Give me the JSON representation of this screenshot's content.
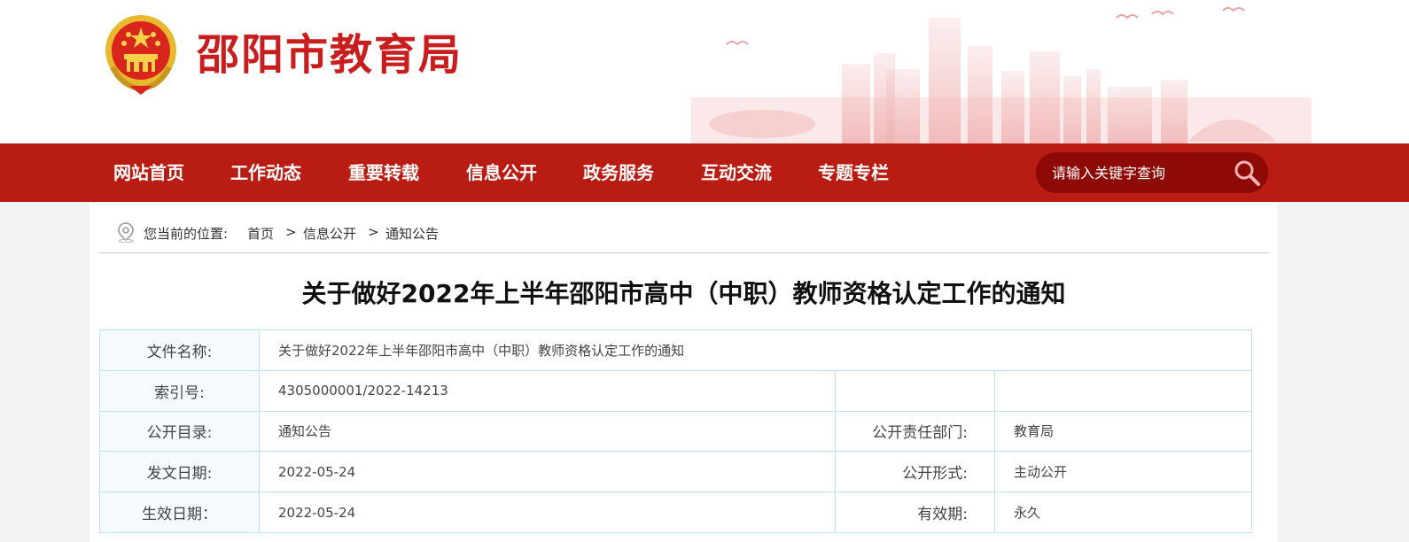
{
  "header": {
    "site_title": "邵阳市教育局"
  },
  "nav": {
    "items": [
      "网站首页",
      "工作动态",
      "重要转载",
      "信息公开",
      "政务服务",
      "互动交流",
      "专题专栏"
    ],
    "search_placeholder": "请输入关键字查询"
  },
  "breadcrumb": {
    "prefix": "您当前的位置:",
    "items": [
      "首页",
      "信息公开",
      "通知公告"
    ],
    "separator": ">"
  },
  "article": {
    "title": "关于做好2022年上半年邵阳市高中（中职）教师资格认定工作的通知"
  },
  "info_table": {
    "file_name_label": "文件名称:",
    "file_name": "关于做好2022年上半年邵阳市高中（中职）教师资格认定工作的通知",
    "index_label": "索引号:",
    "index_value": "4305000001/2022-14213",
    "catalog_label": "公开目录:",
    "catalog_value": "通知公告",
    "dept_label": "公开责任部门:",
    "dept_value": "教育局",
    "date_label": "发文日期:",
    "date_value": "2022-05-24",
    "form_label": "公开形式:",
    "form_value": "主动公开",
    "effective_label": "生效日期：",
    "effective_value": "2022-05-24",
    "validity_label": "有效期:",
    "validity_value": "永久"
  },
  "colors": {
    "brand_red": "#c81e1e",
    "nav_red": "#b81c12",
    "search_bg": "#8e0a06",
    "table_border": "#bfe0f2"
  }
}
